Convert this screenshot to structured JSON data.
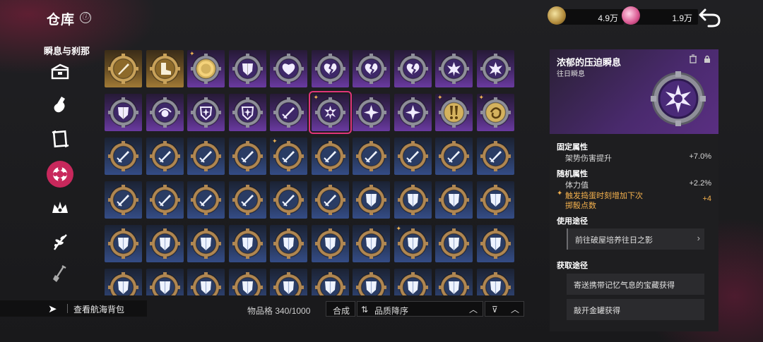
{
  "header": {
    "title": "仓库",
    "info_icon": "ⓘ",
    "currencies": [
      {
        "name": "gold-coin",
        "value": "4.9万",
        "color": "#d7b76a"
      },
      {
        "name": "pink-gem",
        "value": "1.9万",
        "color": "#e06aa0"
      }
    ],
    "back_icon": "back-arrow-icon"
  },
  "category": {
    "title": "瞬息与刹那",
    "items": [
      {
        "name": "chest-icon",
        "active": false
      },
      {
        "name": "bottle-icon",
        "active": false
      },
      {
        "name": "scroll-frame-icon",
        "active": false
      },
      {
        "name": "flower-badge-icon",
        "active": true
      },
      {
        "name": "crown-icon",
        "active": false
      },
      {
        "name": "branch-icon",
        "active": false
      },
      {
        "name": "shovel-icon",
        "active": false
      }
    ]
  },
  "grid": {
    "rows": [
      [
        {
          "bg": "gold",
          "icon": "sword-gold",
          "badge": ""
        },
        {
          "bg": "gold",
          "icon": "boot-gold",
          "badge": ""
        },
        {
          "bg": "purple",
          "icon": "gold-ring",
          "badge": "✦"
        },
        {
          "bg": "purple",
          "icon": "shield",
          "badge": ""
        },
        {
          "bg": "purple",
          "icon": "heart",
          "badge": ""
        },
        {
          "bg": "purple",
          "icon": "broken-heart",
          "badge": ""
        },
        {
          "bg": "purple",
          "icon": "broken-heart",
          "badge": ""
        },
        {
          "bg": "purple",
          "icon": "broken-heart",
          "badge": ""
        },
        {
          "bg": "purple",
          "icon": "burst",
          "badge": ""
        },
        {
          "bg": "purple",
          "icon": "burst",
          "badge": ""
        }
      ],
      [
        {
          "bg": "purple",
          "icon": "shield",
          "badge": ""
        },
        {
          "bg": "purple",
          "icon": "bloom",
          "badge": ""
        },
        {
          "bg": "purple",
          "icon": "star-shield",
          "badge": ""
        },
        {
          "bg": "purple",
          "icon": "star-shield",
          "badge": ""
        },
        {
          "bg": "purple",
          "icon": "sword",
          "badge": ""
        },
        {
          "bg": "purple",
          "icon": "flower-burst",
          "badge": "✦",
          "selected": true
        },
        {
          "bg": "purple",
          "icon": "star",
          "badge": ""
        },
        {
          "bg": "purple",
          "icon": "star",
          "badge": ""
        },
        {
          "bg": "purple",
          "icon": "gold-exclaim",
          "badge": "✦"
        },
        {
          "bg": "purple",
          "icon": "gold-swirl",
          "badge": "✦"
        }
      ],
      [
        {
          "bg": "blue",
          "icon": "sword-blue",
          "badge": ""
        },
        {
          "bg": "blue",
          "icon": "sword-blue",
          "badge": ""
        },
        {
          "bg": "blue",
          "icon": "sword-blue",
          "badge": ""
        },
        {
          "bg": "blue",
          "icon": "sword-blue",
          "badge": ""
        },
        {
          "bg": "blue",
          "icon": "sword-blue",
          "badge": "✦"
        },
        {
          "bg": "blue",
          "icon": "sword-blue",
          "badge": ""
        },
        {
          "bg": "blue",
          "icon": "sword-blue",
          "badge": ""
        },
        {
          "bg": "blue",
          "icon": "sword-blue",
          "badge": ""
        },
        {
          "bg": "blue",
          "icon": "sword-blue",
          "badge": ""
        },
        {
          "bg": "blue",
          "icon": "sword-blue",
          "badge": ""
        }
      ],
      [
        {
          "bg": "blue",
          "icon": "sword-blue",
          "badge": ""
        },
        {
          "bg": "blue",
          "icon": "sword-blue",
          "badge": ""
        },
        {
          "bg": "blue",
          "icon": "sword-blue",
          "badge": ""
        },
        {
          "bg": "blue",
          "icon": "sword-blue",
          "badge": ""
        },
        {
          "bg": "blue",
          "icon": "sword-blue",
          "badge": ""
        },
        {
          "bg": "blue",
          "icon": "sword-blue",
          "badge": ""
        },
        {
          "bg": "blue",
          "icon": "shield-blue",
          "badge": ""
        },
        {
          "bg": "blue",
          "icon": "shield-blue",
          "badge": ""
        },
        {
          "bg": "blue",
          "icon": "shield-blue",
          "badge": ""
        },
        {
          "bg": "blue",
          "icon": "shield-blue",
          "badge": ""
        }
      ],
      [
        {
          "bg": "blue",
          "icon": "shield-blue",
          "badge": ""
        },
        {
          "bg": "blue",
          "icon": "shield-blue",
          "badge": ""
        },
        {
          "bg": "blue",
          "icon": "shield-blue",
          "badge": ""
        },
        {
          "bg": "blue",
          "icon": "shield-blue",
          "badge": ""
        },
        {
          "bg": "blue",
          "icon": "shield-blue",
          "badge": ""
        },
        {
          "bg": "blue",
          "icon": "shield-blue",
          "badge": ""
        },
        {
          "bg": "blue",
          "icon": "shield-blue",
          "badge": ""
        },
        {
          "bg": "blue",
          "icon": "shield-blue",
          "badge": "✦"
        },
        {
          "bg": "blue",
          "icon": "shield-blue",
          "badge": ""
        },
        {
          "bg": "blue",
          "icon": "shield-blue",
          "badge": ""
        }
      ],
      [
        {
          "bg": "blue",
          "icon": "shield-blue",
          "badge": ""
        },
        {
          "bg": "blue",
          "icon": "shield-blue",
          "badge": ""
        },
        {
          "bg": "blue",
          "icon": "shield-blue",
          "badge": ""
        },
        {
          "bg": "blue",
          "icon": "shield-blue",
          "badge": ""
        },
        {
          "bg": "blue",
          "icon": "shield-blue",
          "badge": ""
        },
        {
          "bg": "blue",
          "icon": "shield-blue",
          "badge": ""
        },
        {
          "bg": "blue",
          "icon": "shield-blue",
          "badge": ""
        },
        {
          "bg": "blue",
          "icon": "shield-blue",
          "badge": ""
        },
        {
          "bg": "blue",
          "icon": "shield-blue",
          "badge": ""
        },
        {
          "bg": "blue",
          "icon": "shield-blue",
          "badge": ""
        }
      ]
    ]
  },
  "bottom": {
    "bag_arrow": "➤",
    "bag_label": "查看航海背包",
    "capacity": "物品格 340/1000",
    "compose": "合成",
    "sort_icon": "⇅",
    "sort_label": "品质降序",
    "sort_chevron": "︿",
    "filter_icon": "⊽",
    "filter_chevron": "︿"
  },
  "detail": {
    "name": "浓郁的压迫瞬息",
    "subtitle": "往日瞬息",
    "fixed_title": "固定属性",
    "fixed": [
      {
        "label": "架势伤害提升",
        "value": "+7.0%"
      }
    ],
    "random_title": "随机属性",
    "random": [
      {
        "label": "体力值",
        "value": "+2.2%"
      }
    ],
    "special": {
      "line1": "触发捣蛋时刻增加下次",
      "line2": "掷骰点数",
      "value": "+4",
      "mark": "✦"
    },
    "usage_title": "使用途径",
    "usage": [
      {
        "label": "前往破屋培养往日之影",
        "chev": "›"
      }
    ],
    "obtain_title": "获取途径",
    "obtain": [
      {
        "label": "寄送携带记忆气息的宝藏获得"
      },
      {
        "label": "敲开金罐获得"
      }
    ]
  },
  "colors": {
    "accent": "#c8285c",
    "gold_text": "#f3b04d",
    "purple_bg": "#5b2d8a",
    "blue_bg": "#2c3f6a",
    "gold_bg": "#8a6a2f"
  }
}
